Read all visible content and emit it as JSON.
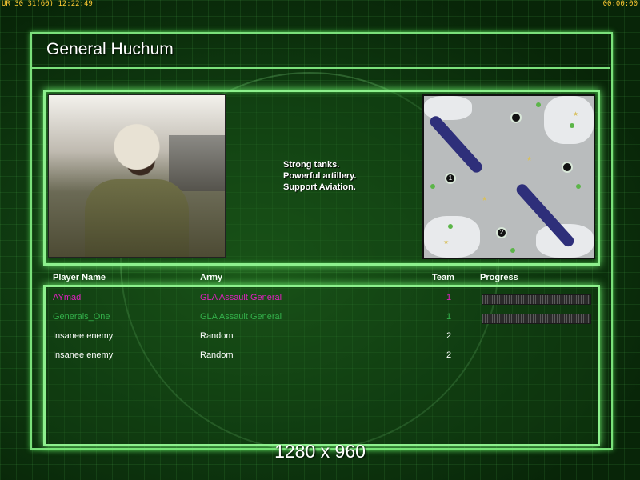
{
  "hud": {
    "left": "UR 30 31(60) 12:22:49",
    "right": "00:00:00"
  },
  "general": {
    "name": "General Huchum",
    "description": [
      "Strong tanks.",
      "Powerful artillery.",
      "Support Aviation."
    ]
  },
  "minimap": {
    "markers": [
      "1",
      "2",
      "",
      ""
    ]
  },
  "players": {
    "headers": {
      "name": "Player Name",
      "army": "Army",
      "team": "Team",
      "progress": "Progress"
    },
    "rows": [
      {
        "name": "AYmad",
        "army": "GLA Assault General",
        "team": "1",
        "color": "#e020c0",
        "progress": 0
      },
      {
        "name": "Generals_One",
        "army": "GLA Assault General",
        "team": "1",
        "color": "#33b04a",
        "progress": 0
      },
      {
        "name": "Insanee enemy",
        "army": "Random",
        "team": "2",
        "color": "#ffffff"
      },
      {
        "name": "Insanee enemy",
        "army": "Random",
        "team": "2",
        "color": "#ffffff"
      }
    ]
  },
  "footer": {
    "resolution": "1280 x 960"
  },
  "colors": {
    "frame": "#8df08d",
    "background": "#0a2e0a"
  }
}
